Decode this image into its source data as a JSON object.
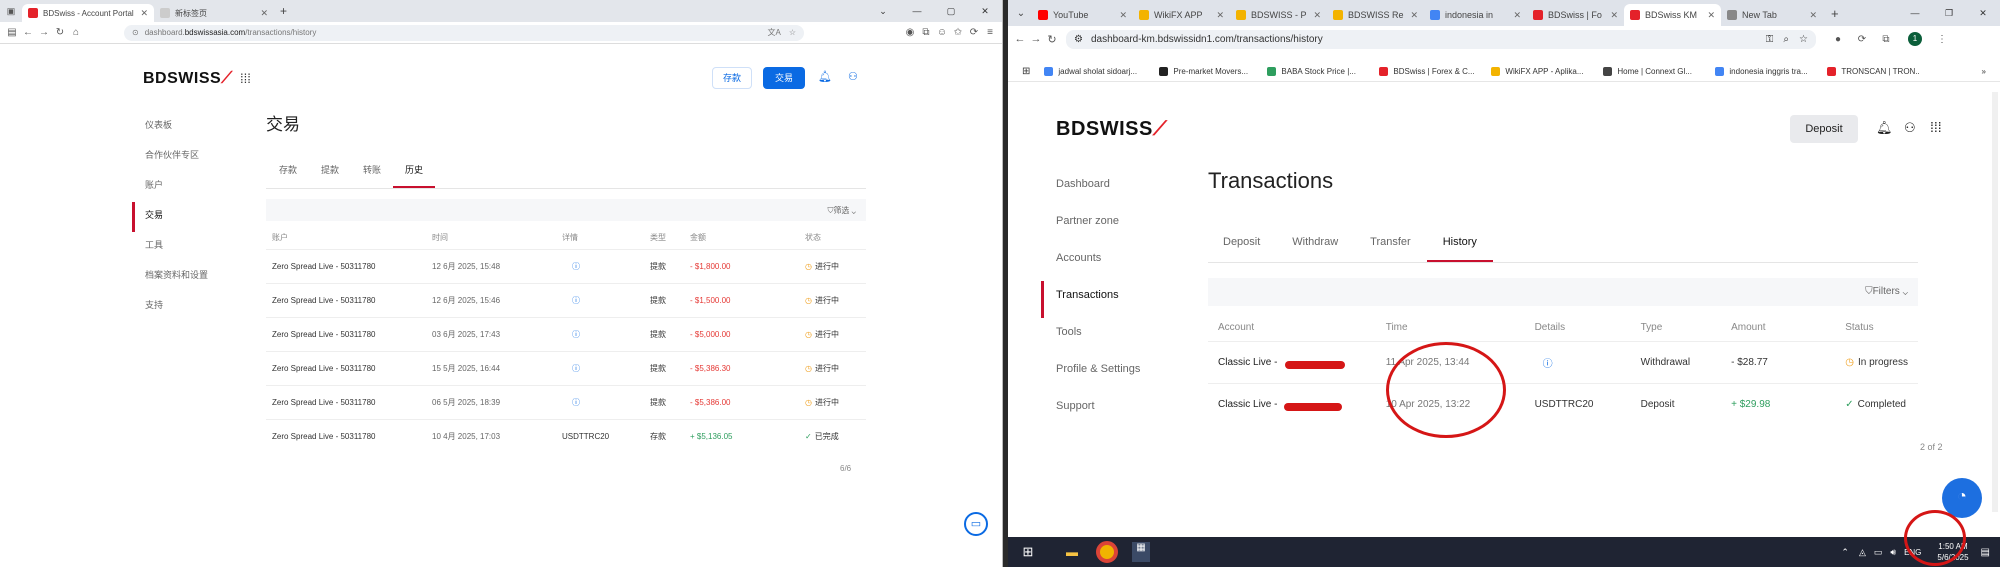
{
  "left": {
    "tabs": [
      {
        "label": "BDSwiss - Account Portal"
      },
      {
        "label": "新标签页"
      }
    ],
    "url_prefix": "dashboard.",
    "url_domain": "bdswissasia.com",
    "url_path": "/transactions/history",
    "logo_text": "BDSWISS",
    "header": {
      "deposit": "存款",
      "trade": "交易"
    },
    "sidebar": [
      "仪表板",
      "合作伙伴专区",
      "账户",
      "交易",
      "工具",
      "档案资料和设置",
      "支持"
    ],
    "title": "交易",
    "sub_tabs": [
      "存款",
      "提款",
      "转账",
      "历史"
    ],
    "filter_label": "筛选",
    "columns": [
      "账户",
      "时间",
      "详情",
      "类型",
      "金额",
      "状态"
    ],
    "rows": [
      {
        "account": "Zero Spread Live - 50311780",
        "time": "12 6月 2025, 15:48",
        "details": "ⓘ",
        "type": "提款",
        "amount": "- $1,800.00",
        "status": "进行中",
        "kind": "neg",
        "done": false
      },
      {
        "account": "Zero Spread Live - 50311780",
        "time": "12 6月 2025, 15:46",
        "details": "ⓘ",
        "type": "提款",
        "amount": "- $1,500.00",
        "status": "进行中",
        "kind": "neg",
        "done": false
      },
      {
        "account": "Zero Spread Live - 50311780",
        "time": "03 6月 2025, 17:43",
        "details": "ⓘ",
        "type": "提款",
        "amount": "- $5,000.00",
        "status": "进行中",
        "kind": "neg",
        "done": false
      },
      {
        "account": "Zero Spread Live - 50311780",
        "time": "15 5月 2025, 16:44",
        "details": "ⓘ",
        "type": "提款",
        "amount": "- $5,386.30",
        "status": "进行中",
        "kind": "neg",
        "done": false
      },
      {
        "account": "Zero Spread Live - 50311780",
        "time": "06 5月 2025, 18:39",
        "details": "ⓘ",
        "type": "提款",
        "amount": "- $5,386.00",
        "status": "进行中",
        "kind": "neg",
        "done": false
      },
      {
        "account": "Zero Spread Live - 50311780",
        "time": "10 4月 2025, 17:03",
        "details": "USDTTRC20",
        "type": "存款",
        "amount": "+ $5,136.05",
        "status": "已完成",
        "kind": "pos",
        "done": true
      }
    ],
    "pager": "6/6"
  },
  "right": {
    "tabs": [
      {
        "label": "YouTube",
        "color": "#ff0000"
      },
      {
        "label": "WikiFX APP",
        "color": "#f3b300"
      },
      {
        "label": "BDSWISS - P",
        "color": "#f3b300"
      },
      {
        "label": "BDSWISS Re",
        "color": "#f3b300"
      },
      {
        "label": "indonesia in",
        "color": "#4285f4"
      },
      {
        "label": "BDSwiss | Fo",
        "color": "#e4222a"
      },
      {
        "label": "BDSwiss KM",
        "color": "#e4222a"
      },
      {
        "label": "New Tab",
        "color": "#888888"
      }
    ],
    "url": "dashboard-km.bdswissidn1.com/transactions/history",
    "avatar": "1",
    "bookmarks": [
      "jadwal sholat sidoarj...",
      "Pre-market Movers...",
      "BABA Stock Price |...",
      "BDSwiss | Forex & C...",
      "WikiFX APP - Aplika...",
      "Home | Connext Gl...",
      "indonesia inggris tra...",
      "TRONSCAN | TRON..."
    ],
    "logo_text": "BDSWISS",
    "deposit_button": "Deposit",
    "sidebar": [
      "Dashboard",
      "Partner zone",
      "Accounts",
      "Transactions",
      "Tools",
      "Profile & Settings",
      "Support"
    ],
    "title": "Transactions",
    "sub_tabs": [
      "Deposit",
      "Withdraw",
      "Transfer",
      "History"
    ],
    "filter_label": "Filters",
    "columns": [
      "Account",
      "Time",
      "Details",
      "Type",
      "Amount",
      "Status"
    ],
    "rows": [
      {
        "account": "Classic Live -",
        "time": "11 Apr 2025, 13:44",
        "details": "ⓘ",
        "type": "Withdrawal",
        "amount": "- $28.77",
        "status": "In progress",
        "kind": "neg",
        "done": false
      },
      {
        "account": "Classic Live -",
        "time": "10 Apr 2025, 13:22",
        "details": "USDTTRC20",
        "type": "Deposit",
        "amount": "+ $29.98",
        "status": "Completed",
        "kind": "pos",
        "done": true
      }
    ],
    "pager": "2 of 2",
    "taskbar": {
      "lang": "ENG",
      "time": "1:50 AM",
      "date": "5/6/2025"
    }
  }
}
